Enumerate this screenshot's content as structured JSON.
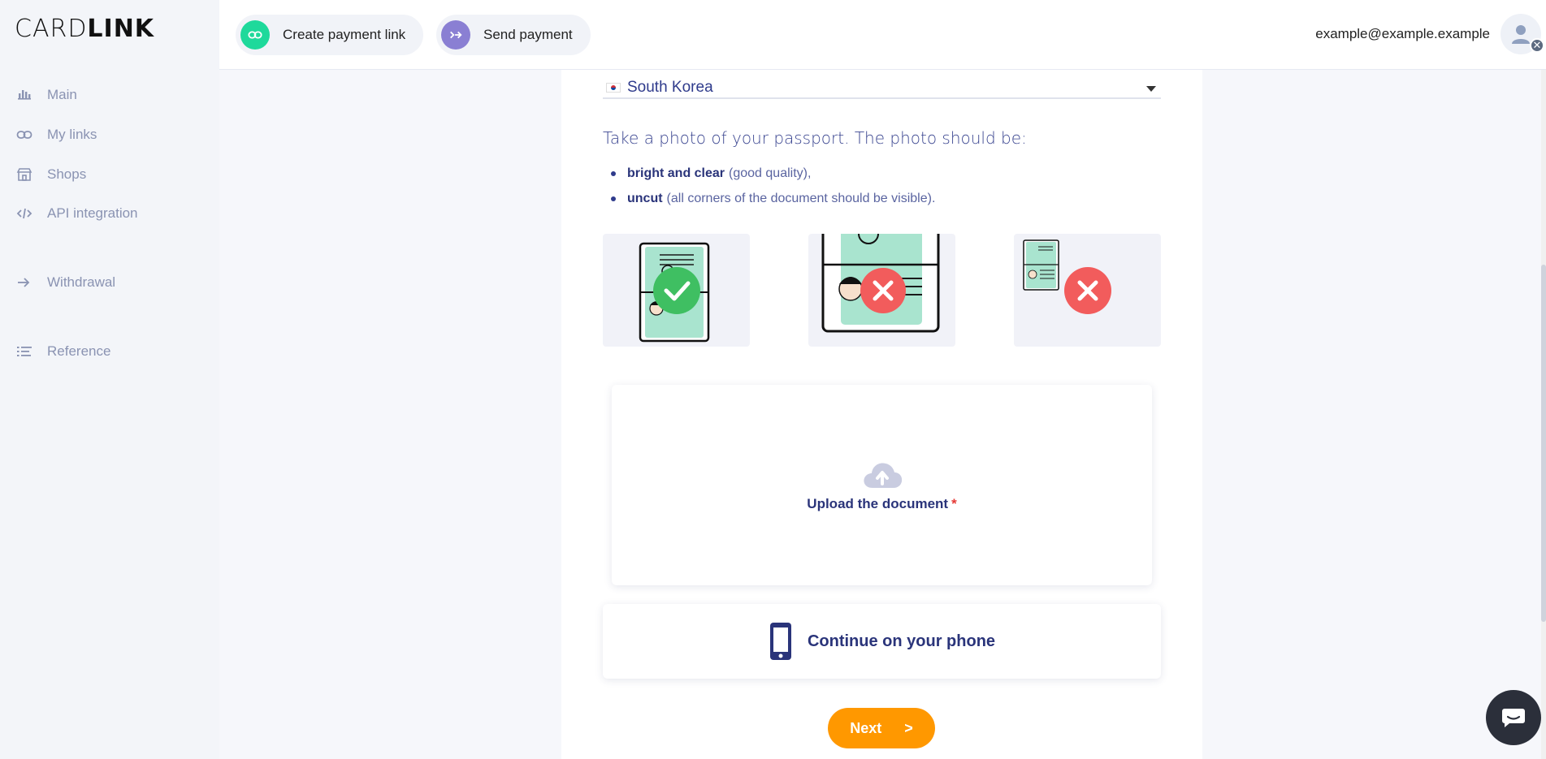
{
  "brand": {
    "logo_thin": "CARD",
    "logo_bold": "LINK"
  },
  "sidebar": {
    "items": [
      {
        "label": "Main",
        "icon": "bar-chart-icon"
      },
      {
        "label": "My links",
        "icon": "link-icon"
      },
      {
        "label": "Shops",
        "icon": "store-icon"
      },
      {
        "label": "API integration",
        "icon": "code-icon"
      },
      {
        "label": "Withdrawal",
        "icon": "double-arrow-icon"
      },
      {
        "label": "Reference",
        "icon": "list-icon"
      }
    ]
  },
  "header": {
    "create_link_label": "Create payment link",
    "send_payment_label": "Send payment",
    "email": "example@example.example"
  },
  "form": {
    "country": "South Korea",
    "instruction": "Take a photo of your passport. The photo should be:",
    "rules": [
      {
        "bold": "bright and clear",
        "text": "(good quality),"
      },
      {
        "bold": "uncut",
        "text": "(all corners of the document should be visible)."
      }
    ],
    "examples": [
      {
        "status": "correct"
      },
      {
        "status": "too-close"
      },
      {
        "status": "too-small"
      }
    ],
    "upload_label": "Upload the document",
    "upload_required": "*",
    "phone_label": "Continue on your phone",
    "next_label": "Next",
    "next_arrow": ">"
  },
  "colors": {
    "accent_green": "#1ed99b",
    "accent_purple": "#8a7fd3",
    "accent_orange": "#ff9800",
    "text_navy": "#2a347a"
  }
}
